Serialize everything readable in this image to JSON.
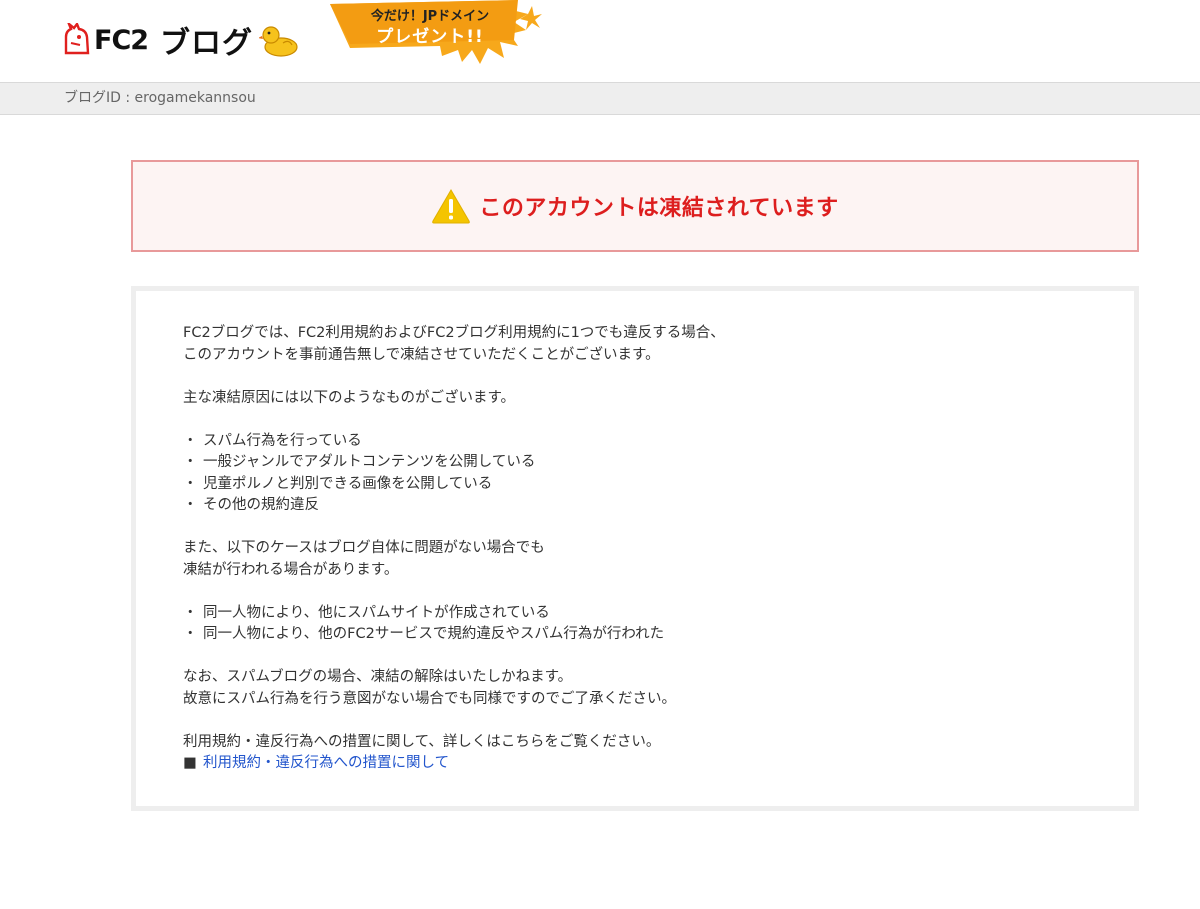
{
  "header": {
    "logo_text": "FC2",
    "logo_sub": "ブログ",
    "promo": {
      "line1": "今だけ！JPドメイン",
      "line2": "プレゼント!!"
    }
  },
  "idbar": {
    "text": "ブログID : erogamekannsou"
  },
  "alert": {
    "message": "このアカウントは凍結されています",
    "color": "#dd1e1e"
  },
  "content": {
    "intro_line1": "FC2ブログでは、FC2利用規約およびFC2ブログ利用規約に1つでも違反する場合、",
    "intro_line2": "このアカウントを事前通告無しで凍結させていただくことがございます。",
    "reasons_heading": "主な凍結原因には以下のようなものがございます。",
    "reasons": [
      "スパム行為を行っている",
      "一般ジャンルでアダルトコンテンツを公開している",
      "児童ポルノと判別できる画像を公開している",
      "その他の規約違反"
    ],
    "also_line1": "また、以下のケースはブログ自体に問題がない場合でも",
    "also_line2": "凍結が行われる場合があります。",
    "cases": [
      "同一人物により、他にスパムサイトが作成されている",
      "同一人物により、他のFC2サービスで規約違反やスパム行為が行われた"
    ],
    "note_line1": "なお、スパムブログの場合、凍結の解除はいたしかねます。",
    "note_line2": "故意にスパム行為を行う意図がない場合でも同様ですのでご了承ください。",
    "terms_line": "利用規約・違反行為への措置に関して、詳しくはこちらをご覧ください。",
    "bullet_char": "・",
    "square_char": "■",
    "terms_link": "利用規約・違反行為への措置に関して"
  },
  "colors": {
    "link": "#2255cc",
    "alert_border": "#e8999a",
    "alert_bg": "#fdf4f3",
    "promo_bg": "#f7a81b"
  }
}
